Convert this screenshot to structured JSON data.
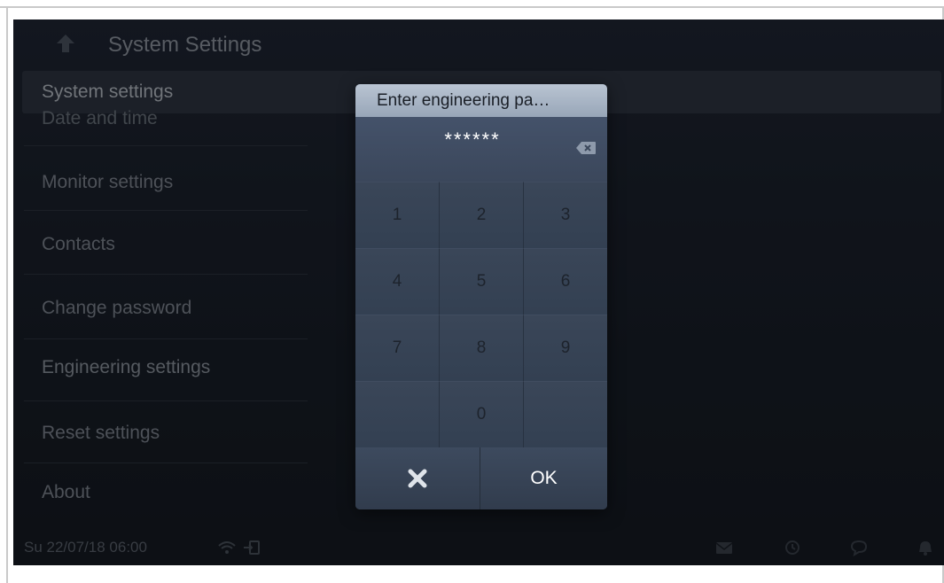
{
  "header": {
    "title": "System Settings",
    "back_icon": "back-arrow-icon"
  },
  "menu": {
    "section_title": "System settings",
    "items": [
      "Date and time",
      "Monitor settings",
      "Contacts",
      "Change password",
      "Engineering settings",
      "Reset settings",
      "About"
    ]
  },
  "status_bar": {
    "datetime": "Su 22/07/18  06:00",
    "icons": [
      "wifi-icon",
      "login-icon",
      "mail-icon",
      "clock-icon",
      "chat-icon",
      "bell-icon"
    ]
  },
  "dialog": {
    "title": "Enter engineering pa…",
    "password_mask": "******",
    "backspace_icon": "backspace-icon",
    "keys": [
      "1",
      "2",
      "3",
      "4",
      "5",
      "6",
      "7",
      "8",
      "9",
      "",
      "0",
      ""
    ],
    "cancel_icon": "close-icon",
    "ok_label": "OK"
  },
  "colors": {
    "dialog_header": "#a9b5c5",
    "screen_bg": "#1b212b",
    "ok_text": "#ffffff"
  }
}
